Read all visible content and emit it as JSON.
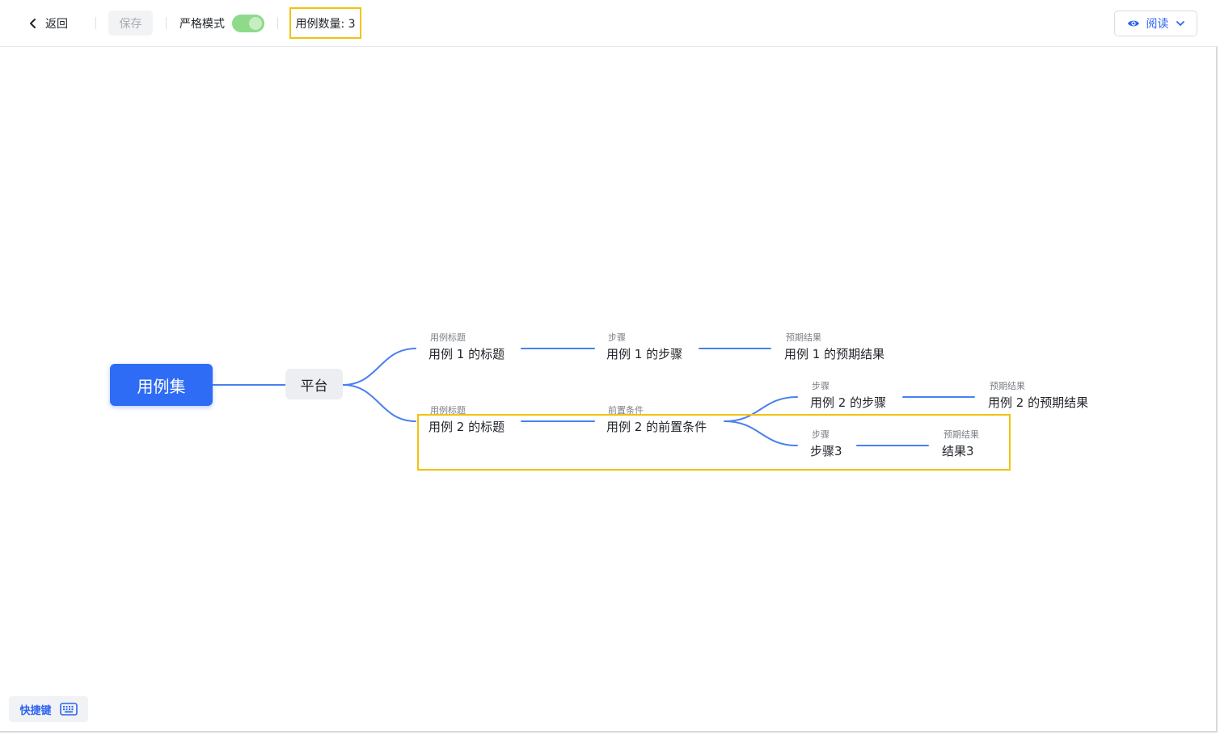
{
  "toolbar": {
    "back_label": "返回",
    "save_label": "保存",
    "strict_mode_label": "严格模式",
    "strict_mode_on": true,
    "case_count_label": "用例数量: 3",
    "read_mode_label": "阅读"
  },
  "mindmap": {
    "root": "用例集",
    "platform": "平台",
    "case1": {
      "title_label": "用例标题",
      "title": "用例 1 的标题",
      "step_label": "步骤",
      "step": "用例 1 的步骤",
      "result_label": "预期结果",
      "result": "用例 1 的预期结果"
    },
    "case2": {
      "title_label": "用例标题",
      "title": "用例 2 的标题",
      "precondition_label": "前置条件",
      "precondition": "用例 2 的前置条件",
      "step_a_label": "步骤",
      "step_a": "用例 2 的步骤",
      "result_a_label": "预期结果",
      "result_a": "用例 2 的预期结果",
      "step_b_label": "步骤",
      "step_b": "步骤3",
      "result_b_label": "预期结果",
      "result_b": "结果3"
    }
  },
  "footer": {
    "shortcut_label": "快捷键"
  },
  "colors": {
    "accent": "#2f6cf6",
    "link": "#4a80f0",
    "highlight": "#f2c20f",
    "toggle_on": "#8fd98a"
  },
  "icons": {
    "back": "chevron-left-icon",
    "read": "eye-icon",
    "dropdown": "chevron-down-icon",
    "shortcut": "keyboard-icon"
  }
}
